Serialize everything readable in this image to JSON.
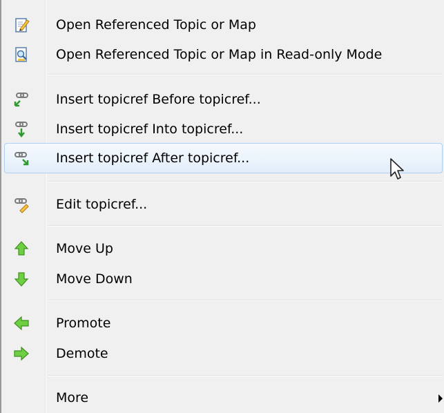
{
  "menu": {
    "items": [
      {
        "label": "Open Referenced Topic or Map",
        "icon": "edit-document-icon"
      },
      {
        "label": "Open Referenced Topic or Map in Read-only Mode",
        "icon": "readonly-document-icon"
      },
      {
        "label": "Insert topicref Before topicref...",
        "icon": "link-insert-before-icon"
      },
      {
        "label": "Insert topicref Into topicref...",
        "icon": "link-insert-into-icon"
      },
      {
        "label": "Insert topicref After topicref...",
        "icon": "link-insert-after-icon"
      },
      {
        "label": "Edit topicref...",
        "icon": "link-edit-icon"
      },
      {
        "label": "Move Up",
        "icon": "arrow-up-icon"
      },
      {
        "label": "Move Down",
        "icon": "arrow-down-icon"
      },
      {
        "label": "Promote",
        "icon": "arrow-left-icon"
      },
      {
        "label": "Demote",
        "icon": "arrow-right-icon"
      },
      {
        "label": "More",
        "icon": ""
      }
    ],
    "highlighted_item": "Insert topicref After topicref...",
    "colors": {
      "highlight_border": "#aecff7",
      "highlight_fill": "#e3eefa",
      "arrow_green": "#4caf2a",
      "menu_background": "#f0f0f0"
    }
  }
}
